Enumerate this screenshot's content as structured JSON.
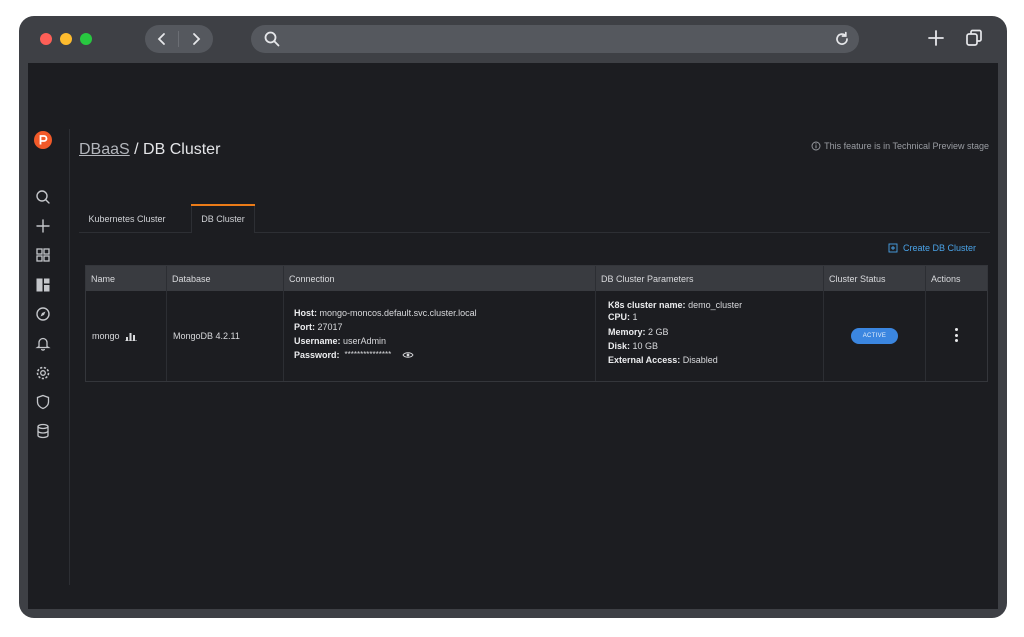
{
  "browser": {
    "traffic_lights": [
      "#fe5f57",
      "#febc2e",
      "#28c840"
    ],
    "nav": {
      "back_icon": "chevron-left-icon",
      "forward_icon": "chevron-right-icon"
    },
    "url_placeholder": "",
    "icons": [
      "search-icon",
      "reload-icon",
      "new-tab-icon",
      "tabs-overview-icon"
    ]
  },
  "sidebar": {
    "items": [
      "logo-icon",
      "search-icon",
      "plus-icon",
      "dashboard-grid-icon",
      "dbaas-icon",
      "explore-icon",
      "alerting-bell-icon",
      "settings-gear-icon",
      "security-shield-icon",
      "database-icon"
    ]
  },
  "breadcrumb": {
    "parent": "DBaaS",
    "separator": " / ",
    "current": "DB Cluster"
  },
  "notice": {
    "icon": "info-circle-icon",
    "text": "This feature is in Technical Preview stage"
  },
  "tabs": [
    {
      "label": "Kubernetes Cluster",
      "active": false
    },
    {
      "label": "DB Cluster",
      "active": true
    }
  ],
  "create_button": {
    "icon": "plus-square-icon",
    "label": "Create DB Cluster"
  },
  "table": {
    "headers": [
      "Name",
      "Database",
      "Connection",
      "DB Cluster Parameters",
      "Cluster Status",
      "Actions"
    ],
    "rows": [
      {
        "name": "mongo",
        "name_icon": "bar-chart-icon",
        "database": "MongoDB 4.2.11",
        "connection": [
          {
            "label": "Host:",
            "value": "mongo-moncos.default.svc.cluster.local"
          },
          {
            "label": "Port:",
            "value": "27017"
          },
          {
            "label": "Username:",
            "value": "userAdmin"
          },
          {
            "label": "Password:",
            "value": "***************"
          }
        ],
        "password_icon": "eye-icon",
        "parameters": [
          {
            "label": "K8s cluster name:",
            "value": "demo_cluster"
          },
          {
            "label": "CPU:",
            "value": "1"
          },
          {
            "label": "Memory:",
            "value": "2 GB"
          },
          {
            "label": "Disk:",
            "value": "10 GB"
          },
          {
            "label": "External Access:",
            "value": "Disabled"
          }
        ],
        "status": "ACTIVE",
        "actions_icon": "kebab-menu-icon"
      }
    ]
  },
  "colors": {
    "accent_tab": "#eb7b18",
    "link_blue": "#4aa3e8",
    "status_active": "#3b86e0",
    "background": "#1c1d21"
  }
}
